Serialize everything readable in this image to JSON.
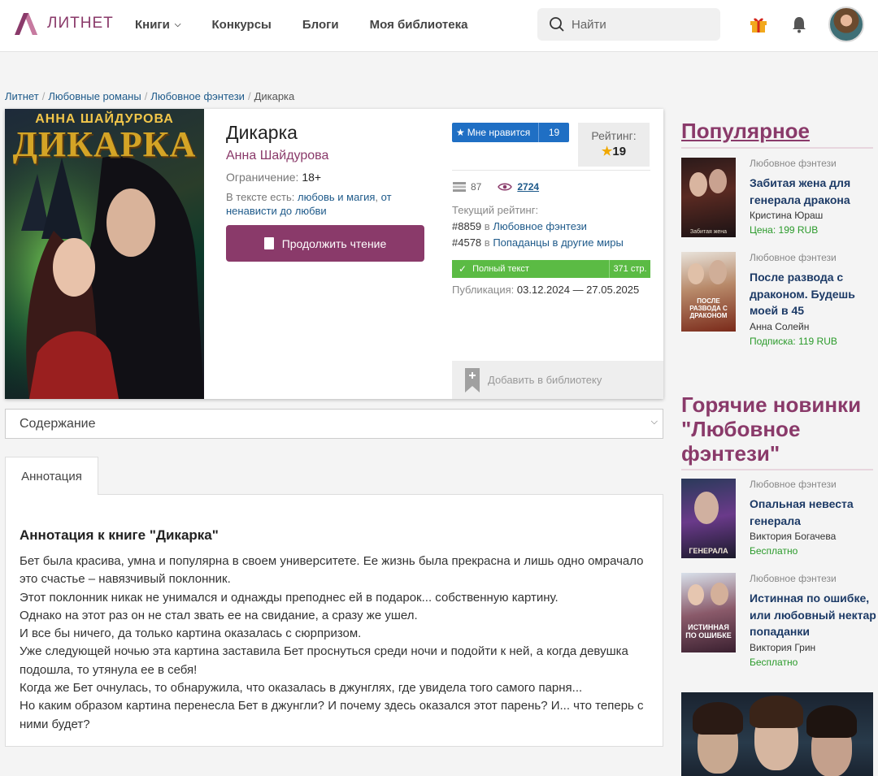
{
  "header": {
    "logo_text": "ЛИТНЕТ",
    "nav": [
      "Книги",
      "Конкурсы",
      "Блоги",
      "Моя библиотека"
    ],
    "search_placeholder": "Найти",
    "icons": [
      "gift-icon",
      "bell-icon",
      "avatar"
    ],
    "accent_color": "#8a3a6a"
  },
  "breadcrumb": {
    "items": [
      "Литнет",
      "Любовные романы",
      "Любовное фэнтези"
    ],
    "current": "Дикарка"
  },
  "book": {
    "cover_author": "АННА ШАЙДУРОВА",
    "cover_title": "ДИКАРКА",
    "title": "Дикарка",
    "author": "Анна Шайдурова",
    "limit_label": "Ограничение:",
    "limit_value": "18+",
    "tags_label": "В тексте есть:",
    "tags": [
      "любовь и магия",
      "от ненависти до любви"
    ],
    "read_button": "Продолжить чтение",
    "like_label": "Мне нравится",
    "like_count": "19",
    "rating_label": "Рейтинг:",
    "rating_value": "19",
    "libraries_count": "87",
    "views_count": "2724",
    "current_rating_label": "Текущий рейтинг:",
    "rank1": "#8859",
    "rank1_in": "в",
    "rank1_genre": "Любовное фэнтези",
    "rank2": "#4578",
    "rank2_in": "в",
    "rank2_genre": "Попаданцы в другие миры",
    "full_text_label": "Полный текст",
    "pages": "371 стр.",
    "pub_label": "Публикация:",
    "pub_dates": "03.12.2024 — 27.05.2025",
    "add_library": "Добавить в библиотеку"
  },
  "contents_select": "Содержание",
  "annotation": {
    "tab": "Аннотация",
    "heading": "Аннотация к книге \"Дикарка\"",
    "lines": [
      "Бет была красива, умна и популярна в своем университете. Ее жизнь была прекрасна и лишь одно омрачало это счастье – навязчивый поклонник.",
      "Этот поклонник никак не унимался и однажды преподнес ей в подарок... собственную картину.",
      "Однако на этот раз он не стал звать ее на свидание, а сразу же ушел.",
      "И все бы ничего, да только картина оказалась с сюрпризом.",
      "Уже следующей ночью эта картина заставила Бет проснуться среди ночи и подойти к ней, а когда девушка подошла, то утянула ее в себя!",
      "Когда же Бет очнулась, то обнаружила, что оказалась в джунглях, где увидела того самого парня...",
      "Но каким образом картина перенесла Бет в джунгли? И почему здесь оказался этот парень? И... что теперь с ними будет?"
    ]
  },
  "sidebar": {
    "popular_title": "Популярное",
    "popular": [
      {
        "genre": "Любовное фэнтези",
        "title": "Забитая жена для генерала дракона",
        "author": "Кристина Юраш",
        "price": "Цена: 199 RUB",
        "cover_text": "Забитая жена"
      },
      {
        "genre": "Любовное фэнтези",
        "title": "После развода с драконом. Будешь моей в 45",
        "author": "Анна Солейн",
        "price": "Подписка: 119 RUB",
        "cover_text": "ПОСЛЕ РАЗВОДА С ДРАКОНОМ"
      }
    ],
    "hot_title": "Горячие новинки \"Любовное фэнтези\"",
    "hot": [
      {
        "genre": "Любовное фэнтези",
        "title": "Опальная невеста генерала",
        "author": "Виктория Богачева",
        "price": "Бесплатно",
        "cover_text": "ГЕНЕРАЛА"
      },
      {
        "genre": "Любовное фэнтези",
        "title": "Истинная по ошибке, или любовный нектар попаданки",
        "author": "Виктория Грин",
        "price": "Бесплатно",
        "cover_text": "ИСТИННАЯ ПО ОШИБКЕ"
      }
    ]
  }
}
